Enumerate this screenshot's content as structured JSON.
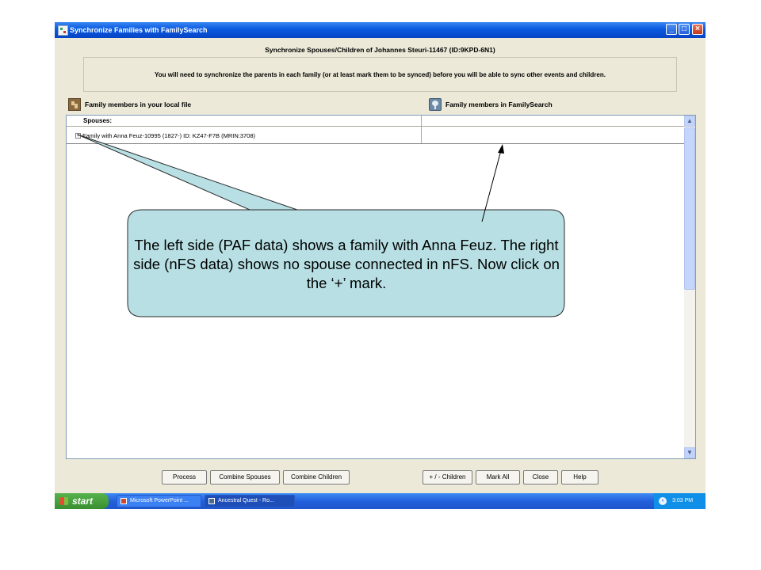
{
  "window": {
    "title": "Synchronize Families with FamilySearch",
    "dialog_title": "Synchronize Spouses/Children of Johannes Steuri-11467  (ID:9KPD-6N1)",
    "notice": "You will need to synchronize the parents in each family (or at least mark them to be synced) before you will be able to sync other events and children."
  },
  "columns": {
    "local": "Family members in your local file",
    "familysearch": "Family members in FamilySearch"
  },
  "grid": {
    "section_label": "Spouses:",
    "rows": [
      {
        "expander": "+",
        "local": "Family with Anna Feuz-10995 (1827-)  ID: KZ47-F7B (MRIN:3708)",
        "familysearch": ""
      }
    ]
  },
  "buttons": {
    "process": "Process",
    "combine_spouses": "Combine Spouses",
    "combine_children": "Combine Children",
    "plus_minus_children": "+ / - Children",
    "mark_all": "Mark All",
    "close": "Close",
    "help": "Help"
  },
  "taskbar": {
    "start": "start",
    "tasks": [
      "Microsoft PowerPoint ...",
      "Ancestral Quest - Ro..."
    ],
    "clock": "3:03 PM"
  },
  "callout": {
    "text": "The left side (PAF data) shows a family with Anna Feuz.  The right side (nFS data) shows no spouse connected in nFS.  Now click on the ‘+’ mark."
  },
  "colors": {
    "callout_fill": "#b8e0e4",
    "titlebar": "#0a5ae0",
    "dialog_bg": "#ece9d8"
  }
}
